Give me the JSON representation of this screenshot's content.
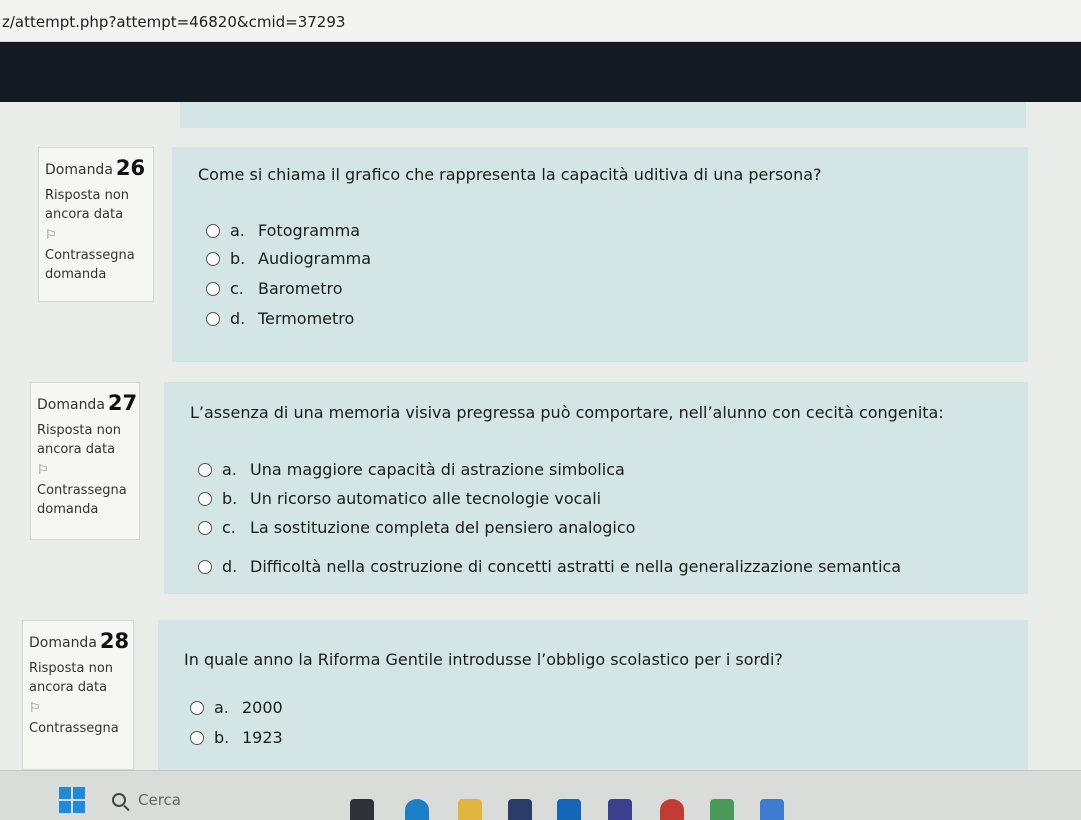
{
  "browser": {
    "url": "z/attempt.php?attempt=46820&cmid=37293"
  },
  "questions": [
    {
      "number_label": "Domanda",
      "number": "26",
      "state": "Risposta non ancora data",
      "flag_label": "Contrassegna domanda",
      "text": "Come si chiama il grafico che rappresenta la capacità uditiva di una persona?",
      "answers": [
        {
          "letter": "a.",
          "text": "Fotogramma"
        },
        {
          "letter": "b.",
          "text": "Audiogramma"
        },
        {
          "letter": "c.",
          "text": "Barometro"
        },
        {
          "letter": "d.",
          "text": "Termometro"
        }
      ]
    },
    {
      "number_label": "Domanda",
      "number": "27",
      "state": "Risposta non ancora data",
      "flag_label": "Contrassegna domanda",
      "text": "L’assenza di una memoria visiva pregressa può comportare, nell’alunno con cecità congenita:",
      "answers": [
        {
          "letter": "a.",
          "text": "Una maggiore capacità di astrazione simbolica"
        },
        {
          "letter": "b.",
          "text": "Un ricorso automatico alle tecnologie vocali"
        },
        {
          "letter": "c.",
          "text": "La sostituzione completa del pensiero analogico"
        },
        {
          "letter": "d.",
          "text": "Difficoltà nella costruzione di concetti astratti e nella generalizzazione semantica"
        }
      ]
    },
    {
      "number_label": "Domanda",
      "number": "28",
      "state": "Risposta non ancora data",
      "flag_label": "Contrassegna",
      "text": "In quale anno la Riforma Gentile introdusse l’obbligo scolastico per i sordi?",
      "answers": [
        {
          "letter": "a.",
          "text": "2000"
        },
        {
          "letter": "b.",
          "text": "1923"
        }
      ]
    }
  ],
  "taskbar": {
    "search_label": "Cerca"
  },
  "icons": {
    "flag": "flag-icon",
    "radio": "radio-button",
    "start": "windows-start-icon",
    "search": "search-icon"
  },
  "colors": {
    "content_bg": "#d3e6e5",
    "info_bg": "#f6f7f3",
    "navbar": "#141a22",
    "start_icon": "#1f8ad8"
  }
}
